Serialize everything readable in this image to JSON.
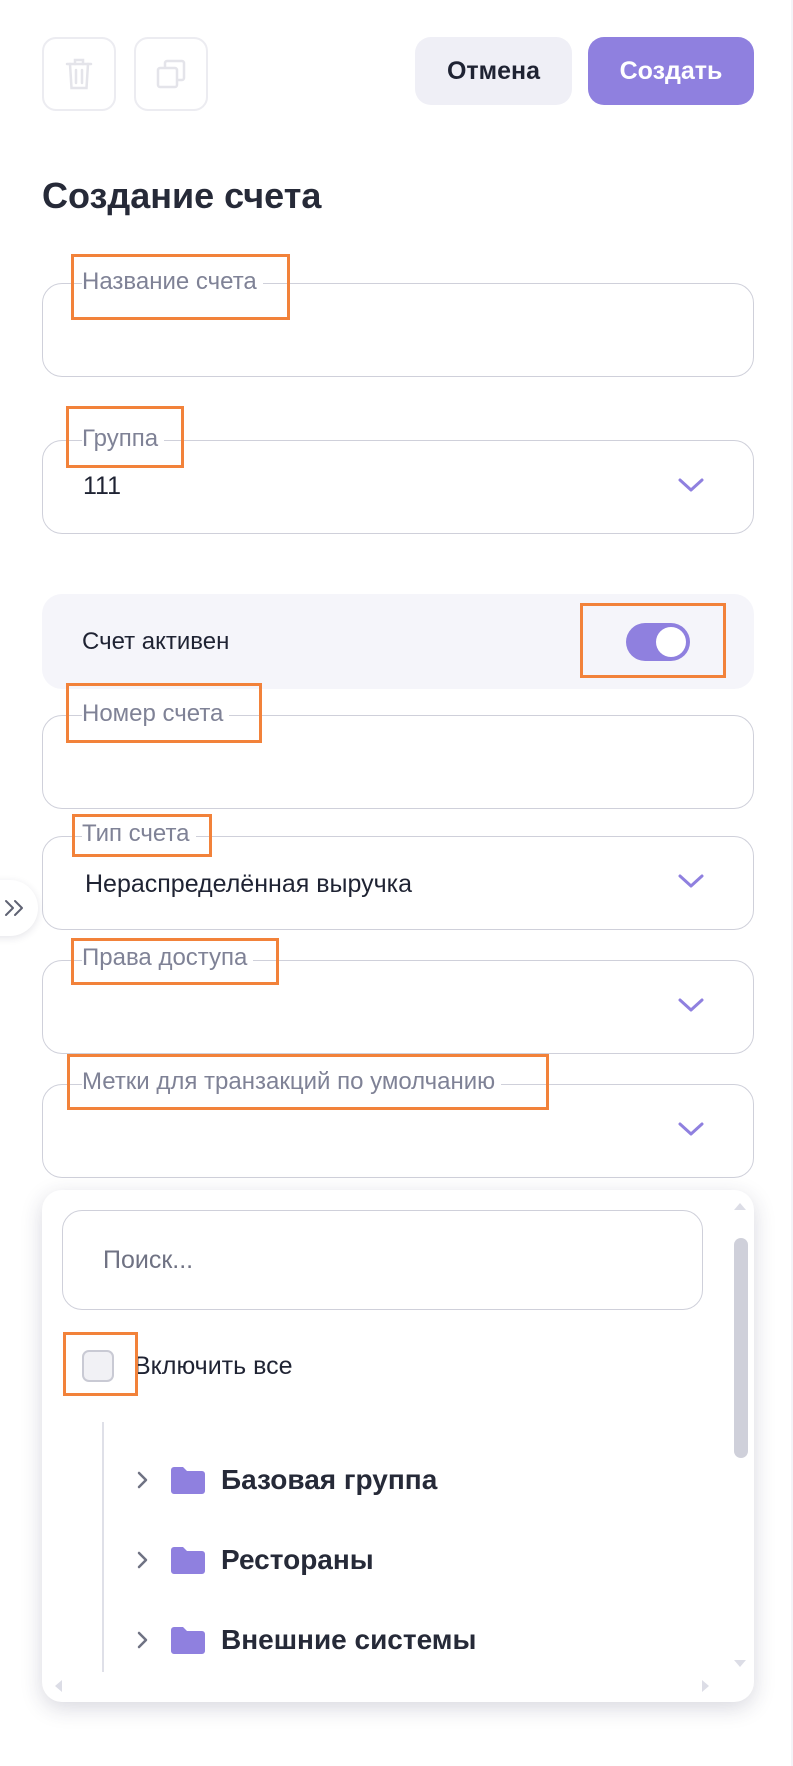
{
  "toolbar": {
    "delete_icon": "trash-icon",
    "copy_icon": "copy-icon",
    "cancel_label": "Отмена",
    "create_label": "Создать"
  },
  "page_title": "Создание счета",
  "fields": {
    "account_name": {
      "label": "Название счета",
      "value": ""
    },
    "group": {
      "label": "Группа",
      "value": "111"
    },
    "active": {
      "label": "Счет активен",
      "on": true
    },
    "account_number": {
      "label": "Номер счета",
      "value": ""
    },
    "account_type": {
      "label": "Тип счета",
      "value": "Нераспределённая выручка"
    },
    "access_rights": {
      "label": "Права доступа",
      "value": ""
    },
    "default_tags": {
      "label": "Метки для транзакций по умолчанию",
      "value": ""
    }
  },
  "dropdown": {
    "search_placeholder": "Поиск...",
    "include_all_label": "Включить все",
    "include_all_checked": false,
    "items": [
      {
        "label": "Базовая группа"
      },
      {
        "label": "Рестораны"
      },
      {
        "label": "Внешние системы"
      }
    ]
  },
  "colors": {
    "accent": "#8f80df",
    "highlight": "#f2823a",
    "border": "#cfd0da"
  }
}
